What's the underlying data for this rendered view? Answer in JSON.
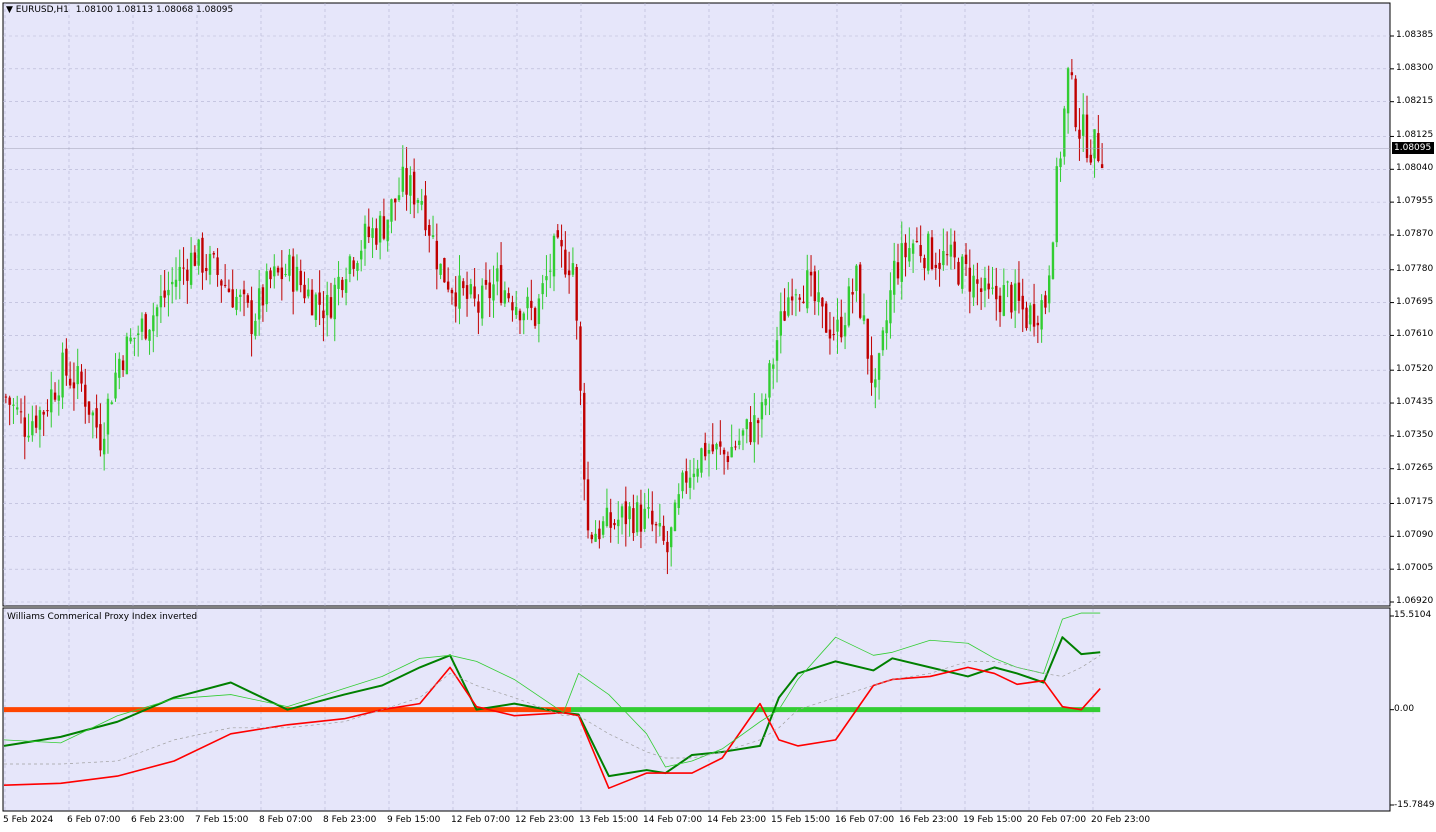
{
  "header": {
    "symbol": "EURUSD,H1",
    "ohlc": "1.08100 1.08113 1.08068 1.08095"
  },
  "current_price": "1.08095",
  "indicator": {
    "title": "Williams Commerical Proxy Index inverted",
    "axis_labels": [
      "15.5104",
      "0.00",
      "-15.7849"
    ]
  },
  "colors": {
    "background": "#e6e6fa",
    "grid": "#b4b4d2",
    "bull": "#32cd32",
    "bear": "#c00000",
    "ind_green_thick": "#008000",
    "ind_green_thin": "#32cd32",
    "ind_red": "#ff0000",
    "ind_orange": "#ff4500"
  },
  "chart_data": [
    {
      "type": "candlestick",
      "title": "EURUSD,H1",
      "y_ticks": [
        "1.08385",
        "1.08300",
        "1.08215",
        "1.08125",
        "1.08040",
        "1.07955",
        "1.07870",
        "1.07780",
        "1.07695",
        "1.07610",
        "1.07520",
        "1.07435",
        "1.07350",
        "1.07265",
        "1.07175",
        "1.07090",
        "1.07005",
        "1.06920"
      ],
      "ylim": [
        1.0692,
        1.0844
      ],
      "x_tick_labels": [
        "5 Feb 2024",
        "6 Feb 07:00",
        "6 Feb 23:00",
        "7 Feb 15:00",
        "8 Feb 07:00",
        "8 Feb 23:00",
        "9 Feb 15:00",
        "12 Feb 07:00",
        "12 Feb 23:00",
        "13 Feb 15:00",
        "14 Feb 07:00",
        "14 Feb 23:00",
        "15 Feb 15:00",
        "16 Feb 07:00",
        "16 Feb 23:00",
        "19 Feb 15:00",
        "20 Feb 07:00",
        "20 Feb 23:00"
      ],
      "close_anchors": [
        [
          0,
          1.0745
        ],
        [
          5,
          1.0738
        ],
        [
          10,
          1.0742
        ],
        [
          15,
          1.0752
        ],
        [
          20,
          1.0748
        ],
        [
          25,
          1.0735
        ],
        [
          30,
          1.0755
        ],
        [
          35,
          1.0762
        ],
        [
          40,
          1.0768
        ],
        [
          45,
          1.0776
        ],
        [
          50,
          1.0782
        ],
        [
          55,
          1.0778
        ],
        [
          60,
          1.0772
        ],
        [
          65,
          1.0765
        ],
        [
          70,
          1.0775
        ],
        [
          75,
          1.0778
        ],
        [
          80,
          1.0772
        ],
        [
          85,
          1.0768
        ],
        [
          90,
          1.078
        ],
        [
          95,
          1.0786
        ],
        [
          100,
          1.079
        ],
        [
          105,
          1.08
        ],
        [
          110,
          1.0797
        ],
        [
          115,
          1.0778
        ],
        [
          120,
          1.0772
        ],
        [
          125,
          1.0768
        ],
        [
          130,
          1.0775
        ],
        [
          135,
          1.077
        ],
        [
          140,
          1.0766
        ],
        [
          145,
          1.0782
        ],
        [
          150,
          1.078
        ],
        [
          154,
          1.071
        ],
        [
          160,
          1.0712
        ],
        [
          165,
          1.0715
        ],
        [
          170,
          1.0713
        ],
        [
          175,
          1.0705
        ],
        [
          180,
          1.0725
        ],
        [
          185,
          1.0732
        ],
        [
          190,
          1.073
        ],
        [
          195,
          1.0735
        ],
        [
          200,
          1.074
        ],
        [
          204,
          1.076
        ],
        [
          208,
          1.0775
        ],
        [
          212,
          1.0774
        ],
        [
          216,
          1.0765
        ],
        [
          220,
          1.0762
        ],
        [
          225,
          1.0775
        ],
        [
          230,
          1.0745
        ],
        [
          235,
          1.0778
        ],
        [
          240,
          1.0785
        ],
        [
          245,
          1.0782
        ],
        [
          250,
          1.078
        ],
        [
          255,
          1.0776
        ],
        [
          260,
          1.077
        ],
        [
          265,
          1.0772
        ],
        [
          270,
          1.0766
        ],
        [
          275,
          1.077
        ],
        [
          278,
          1.08
        ],
        [
          281,
          1.0828
        ],
        [
          284,
          1.0815
        ],
        [
          287,
          1.081
        ],
        [
          290,
          1.0809
        ]
      ],
      "candle_count": 291
    },
    {
      "type": "line",
      "title": "Williams Commerical Proxy Index inverted",
      "ylim": [
        -15.7849,
        15.5104
      ],
      "x": [
        0,
        15,
        30,
        45,
        60,
        75,
        90,
        100,
        110,
        118,
        125,
        135,
        148,
        152,
        160,
        170,
        175,
        182,
        190,
        200,
        205,
        210,
        220,
        230,
        235,
        245,
        255,
        262,
        268,
        275,
        280,
        285,
        290
      ],
      "series": [
        {
          "name": "",
          "values": [
            -6,
            -4.5,
            -2,
            2,
            4.5,
            0,
            2.5,
            4,
            7,
            9,
            0,
            1,
            -0.5,
            -0.8,
            -11,
            -10,
            -10.5,
            -7.5,
            -7,
            -6,
            2,
            6,
            8,
            6.5,
            8.5,
            7,
            5.5,
            7,
            6,
            4.5,
            12,
            9.2,
            9.5
          ]
        },
        {
          "name": "",
          "values": [
            -12.5,
            -12.2,
            -11,
            -8.5,
            -4,
            -2.5,
            -1.5,
            0,
            1,
            7,
            0.5,
            -1,
            -0.5,
            -1,
            -13,
            -10.5,
            -10.5,
            -10.5,
            -8,
            1,
            -5,
            -6,
            -5,
            4,
            5,
            5.5,
            7,
            6,
            4.2,
            4.8,
            0.5,
            0,
            3.5
          ]
        },
        {
          "name": "",
          "values": [
            -5,
            -5.5,
            -1,
            1.8,
            2.5,
            0.5,
            3.5,
            5.5,
            8.5,
            9,
            8,
            5,
            -0.5,
            6,
            2.5,
            -4,
            -9.5,
            -8.5,
            -6.5,
            -2,
            0,
            5,
            12,
            9,
            9.5,
            11.5,
            11,
            8.5,
            7,
            6,
            15,
            16,
            16
          ]
        },
        {
          "name": "",
          "values": [
            -9,
            -9,
            -8.5,
            -5,
            -3,
            -3,
            -2,
            0,
            2,
            6,
            4,
            2,
            -1,
            -1,
            -4,
            -7,
            -8,
            -8,
            -7,
            -5,
            -3,
            0,
            2,
            4,
            5,
            6,
            8,
            8,
            7,
            6,
            5.5,
            7,
            9
          ]
        }
      ]
    }
  ]
}
